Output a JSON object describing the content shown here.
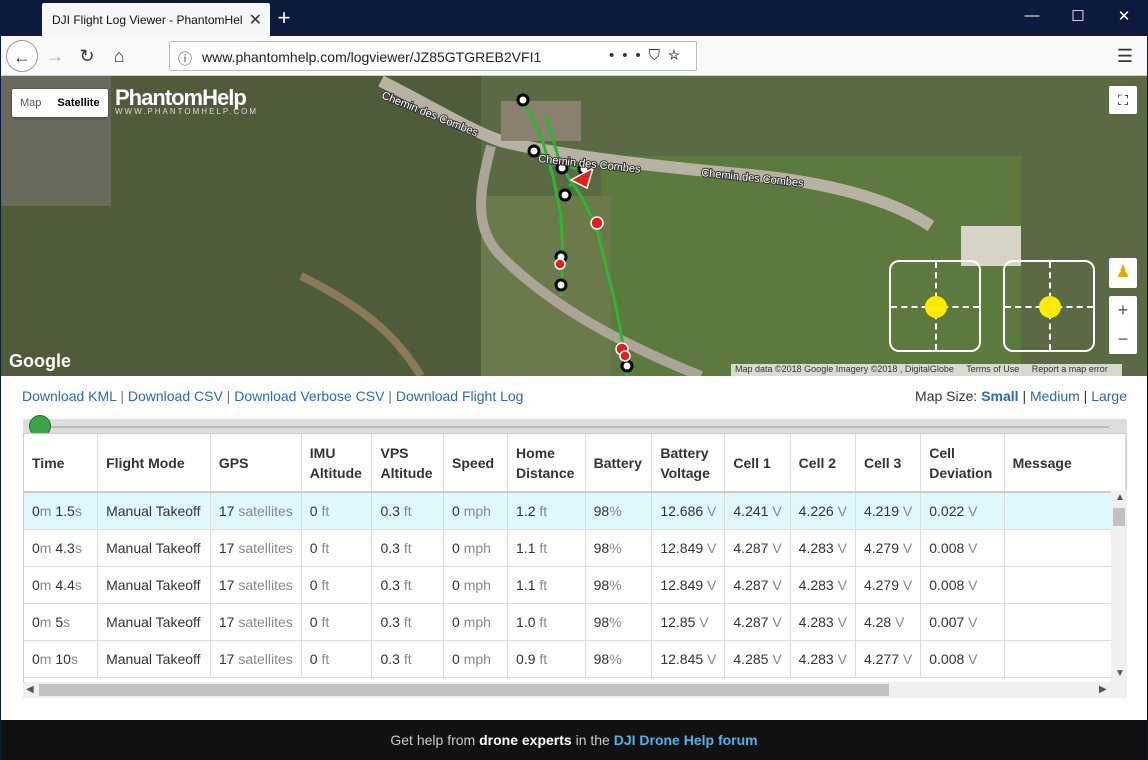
{
  "browser": {
    "tab_title": "DJI Flight Log Viewer - PhantomHelp",
    "url": "www.phantomhelp.com/logviewer/JZ85GTGREB2VFI1"
  },
  "map": {
    "map_label": "Map",
    "satellite_label": "Satellite",
    "logo_text": "PhantomHelp",
    "logo_sub": "WWW.PHANTOMHELP.COM",
    "google_label": "Google",
    "road_labels": [
      "Chemin des Combes",
      "Chemin des Combes",
      "Chemin des Combes"
    ],
    "attribution": {
      "data": "Map data ©2018 Google Imagery ©2018 , DigitalGlobe",
      "terms": "Terms of Use",
      "report": "Report a map error"
    }
  },
  "links": {
    "kml": "Download KML",
    "csv": "Download CSV",
    "verbose_csv": "Download Verbose CSV",
    "flight_log": "Download Flight Log",
    "sep": "|"
  },
  "map_size": {
    "label": "Map Size:",
    "small": "Small",
    "medium": "Medium",
    "large": "Large"
  },
  "table": {
    "headers": [
      "Time",
      "Flight Mode",
      "GPS",
      "IMU Altitude",
      "VPS Altitude",
      "Speed",
      "Home Distance",
      "Battery",
      "Battery Voltage",
      "Cell 1",
      "Cell 2",
      "Cell 3",
      "Cell Deviation",
      "Message"
    ],
    "rows": [
      {
        "time_m": "0",
        "time_s": "1.5",
        "mode": "Manual Takeoff",
        "gps": "17",
        "imu": "0",
        "vps": "0.3",
        "speed": "0",
        "home": "1.2",
        "battery": "98",
        "voltage": "12.686",
        "c1": "4.241",
        "c2": "4.226",
        "c3": "4.219",
        "dev": "0.022"
      },
      {
        "time_m": "0",
        "time_s": "4.3",
        "mode": "Manual Takeoff",
        "gps": "17",
        "imu": "0",
        "vps": "0.3",
        "speed": "0",
        "home": "1.1",
        "battery": "98",
        "voltage": "12.849",
        "c1": "4.287",
        "c2": "4.283",
        "c3": "4.279",
        "dev": "0.008"
      },
      {
        "time_m": "0",
        "time_s": "4.4",
        "mode": "Manual Takeoff",
        "gps": "17",
        "imu": "0",
        "vps": "0.3",
        "speed": "0",
        "home": "1.1",
        "battery": "98",
        "voltage": "12.849",
        "c1": "4.287",
        "c2": "4.283",
        "c3": "4.279",
        "dev": "0.008"
      },
      {
        "time_m": "0",
        "time_s": "5",
        "mode": "Manual Takeoff",
        "gps": "17",
        "imu": "0",
        "vps": "0.3",
        "speed": "0",
        "home": "1.0",
        "battery": "98",
        "voltage": "12.85",
        "c1": "4.287",
        "c2": "4.283",
        "c3": "4.28",
        "dev": "0.007"
      },
      {
        "time_m": "0",
        "time_s": "10",
        "mode": "Manual Takeoff",
        "gps": "17",
        "imu": "0",
        "vps": "0.3",
        "speed": "0",
        "home": "0.9",
        "battery": "98",
        "voltage": "12.845",
        "c1": "4.285",
        "c2": "4.283",
        "c3": "4.277",
        "dev": "0.008"
      }
    ],
    "units": {
      "min": "m",
      "sec": "s",
      "sat": "satellites",
      "ft": "ft",
      "mph": "mph",
      "pct": "%",
      "volt": "V"
    }
  },
  "footer": {
    "pre": "Get help from",
    "bold": "drone experts",
    "mid": "in the",
    "link": "DJI Drone Help forum"
  }
}
